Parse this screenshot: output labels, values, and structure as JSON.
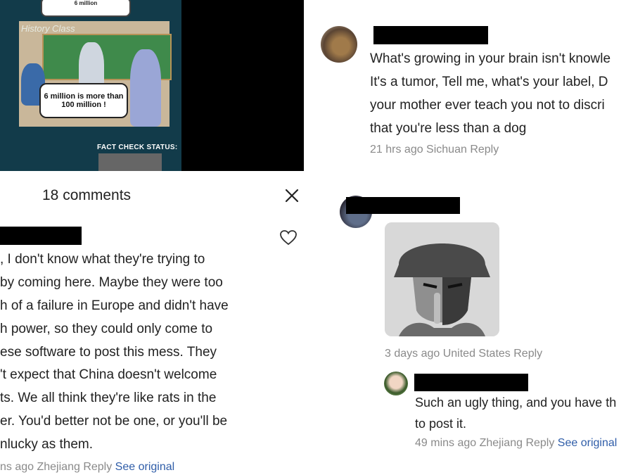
{
  "meme": {
    "top_bubble_text": "6 million",
    "board_caption": "History Class",
    "bubble_text": "6 million is more than 100 million !",
    "fact_check_label": "FACT CHECK STATUS:"
  },
  "left_panel": {
    "comments_title": "18 comments",
    "comment_lines": [
      ", I don't know what they're trying to",
      " by coming here. Maybe they were too",
      "h of a failure in Europe and didn't have",
      "h power, so they could only come to",
      "ese software to post this mess. They",
      "'t expect that China doesn't welcome",
      "ts. We all think they're like rats in the",
      "er. You'd better not be one, or you'll be",
      "nlucky as them."
    ],
    "meta": {
      "time_location": "ns ago Zhejiang",
      "reply": "Reply",
      "see_original": "See original"
    }
  },
  "right_panel": {
    "comment1": {
      "lines": [
        "What's growing in your brain isn't knowle",
        "It's a tumor, Tell me, what's your label, D",
        "your mother ever teach you not to discri",
        "that you're less than a dog"
      ],
      "meta": {
        "time_location": "21 hrs ago Sichuan",
        "reply": "Reply"
      }
    },
    "comment2": {
      "meta": {
        "time_location": "3 days ago United States",
        "reply": "Reply"
      }
    },
    "reply1": {
      "lines": [
        "Such an ugly thing, and you have th",
        "to post it."
      ],
      "meta": {
        "time_location": "49 mins ago Zhejiang",
        "reply": "Reply",
        "see_original": "See original"
      }
    }
  },
  "icons": {
    "close": "close-icon",
    "like": "heart-icon"
  },
  "colors": {
    "link": "#2f5da8",
    "meta": "#8a8a8a",
    "redaction": "#000000"
  }
}
